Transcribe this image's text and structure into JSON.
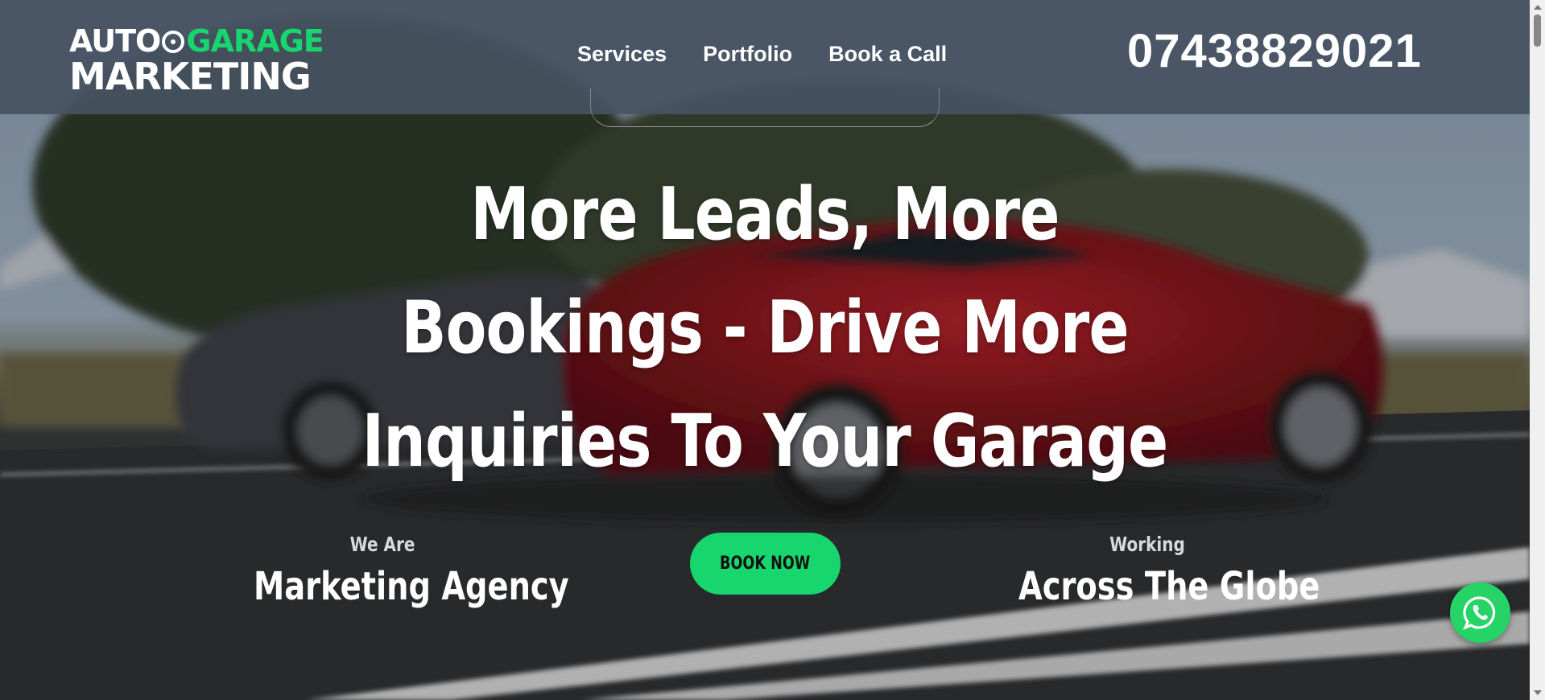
{
  "header": {
    "logo": {
      "word1": "AUTO",
      "word2": "GARAGE",
      "word3": "MARKETING"
    },
    "nav": [
      {
        "label": "Services"
      },
      {
        "label": "Portfolio"
      },
      {
        "label": "Book a Call"
      }
    ],
    "phone": "07438829021"
  },
  "hero": {
    "headline_lines": [
      "More Leads, More",
      "Bookings - Drive More",
      "Inquiries To Your Garage"
    ],
    "left_stat": {
      "small": "We Are",
      "big": "Marketing Agency"
    },
    "cta": "BOOK NOW",
    "right_stat": {
      "small": "Working",
      "big": "Across The Globe"
    }
  },
  "icons": {
    "whatsapp": "whatsapp-icon",
    "logo_wheel": "wheel-icon"
  },
  "colors": {
    "accent": "#17d66d",
    "header_bg": "#465262",
    "whatsapp": "#25d366"
  }
}
